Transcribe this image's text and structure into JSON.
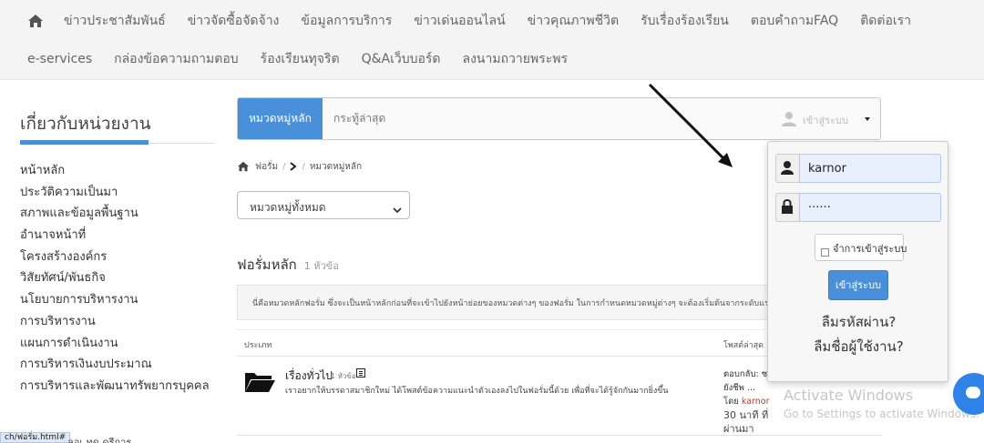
{
  "nav": {
    "row1": [
      "ข่าวประชาสัมพันธ์",
      "ข่าวจัดซื้อจัดจ้าง",
      "ข้อมูลการบริการ",
      "ข่าวเด่นออนไลน์",
      "ข่าวคุณภาพชีวิต",
      "รับเรื่องร้องเรียน",
      "ตอบคำถามFAQ",
      "ติดต่อเรา"
    ],
    "row2": [
      "e-services",
      "กล่องข้อความถามตอบ",
      "ร้องเรียนทุจริต",
      "Q&Aเว็บบอร์ด",
      "ลงนามถวายพระพร"
    ],
    "home_icon": "home-icon"
  },
  "sidebar": {
    "title": "เกี่ยวกับหน่วยงาน",
    "items": [
      "หน้าหลัก",
      "ประวัติความเป็นมา",
      "สภาพและข้อมูลพื้นฐาน",
      "อำนาจหน้าที่",
      "โครงสร้างองค์กร",
      "วิสัยทัศน์/พันธกิจ",
      "นโยบายการบริหารงาน",
      "การบริหารงาน",
      "แผนการดำเนินงาน",
      "การบริหารเงินงบประมาณ",
      "การบริหารและพัฒนาทรัพยากรบุคคล"
    ]
  },
  "forumbar": {
    "active_tab": "หมวดหมู่หลัก",
    "tab": "กระทู้ล่าสุด",
    "user_label": "เข้าสู่ระบบ"
  },
  "breadcrumb": {
    "forum": "ฟอรั่ม",
    "slash": "/",
    "current": "หมวดหมู่หลัก"
  },
  "category_select": {
    "value": "หมวดหมู่ทั้งหมด"
  },
  "section": {
    "title": "ฟอรั่มหลัก",
    "count": "1 หัวข้อ",
    "description": "นี่คือหมวดหลักฟอรั่ม ซึ่งจะเป็นหน้าหลักก่อนที่จะเข้าไปยังหน้าย่อยของหมวดต่างๆ ของฟอรั่ม ในการกำหนดหมวดหมู่ต่างๆ จะต้องเริ่มต้นจากระดับแรกสุด"
  },
  "table": {
    "col_type": "ประเภท",
    "col_last": "โพสต์ล่าสุด",
    "rows": [
      {
        "name": "เรื่องทั่วไป",
        "topics": "1 หัวข้อ",
        "description": "เราอยากให้บรรดาสมาชิกใหม่ ได้โพสต์ข้อความแนะนำตัวเองลงไปในฟอรั่มนี้ด้วย เพื่อที่จะได้รู้จักกันมากยิ่งขึ้น",
        "last_line1": "ตอบกลับ: ช",
        "last_line2": "ยังชีพ ...",
        "last_by": "โดย",
        "last_author": "karnor",
        "last_time": "30 นาที ที่ผ่านมา"
      }
    ]
  },
  "login": {
    "username": "karnor",
    "password": "······",
    "remember_label": "จำการเข้าสู่ระบบ",
    "login_button": "เข้าสู่ระบบ",
    "forgot_password": "ลืมรหัสผ่าน?",
    "forgot_username": "ลืมชื่อผู้ใช้งาน?"
  },
  "watermark": {
    "line1": "Activate Windows",
    "line2": "Go to Settings to activate Windows."
  },
  "status": {
    "url": "ch/ฟอรั่ม.html#",
    "next": "ลอเ ทด ดรีการ"
  },
  "colors": {
    "accent": "#4a8fd9",
    "nav_bg": "#f4f4f4",
    "author": "#c0392b",
    "chat": "#2f82e8"
  }
}
